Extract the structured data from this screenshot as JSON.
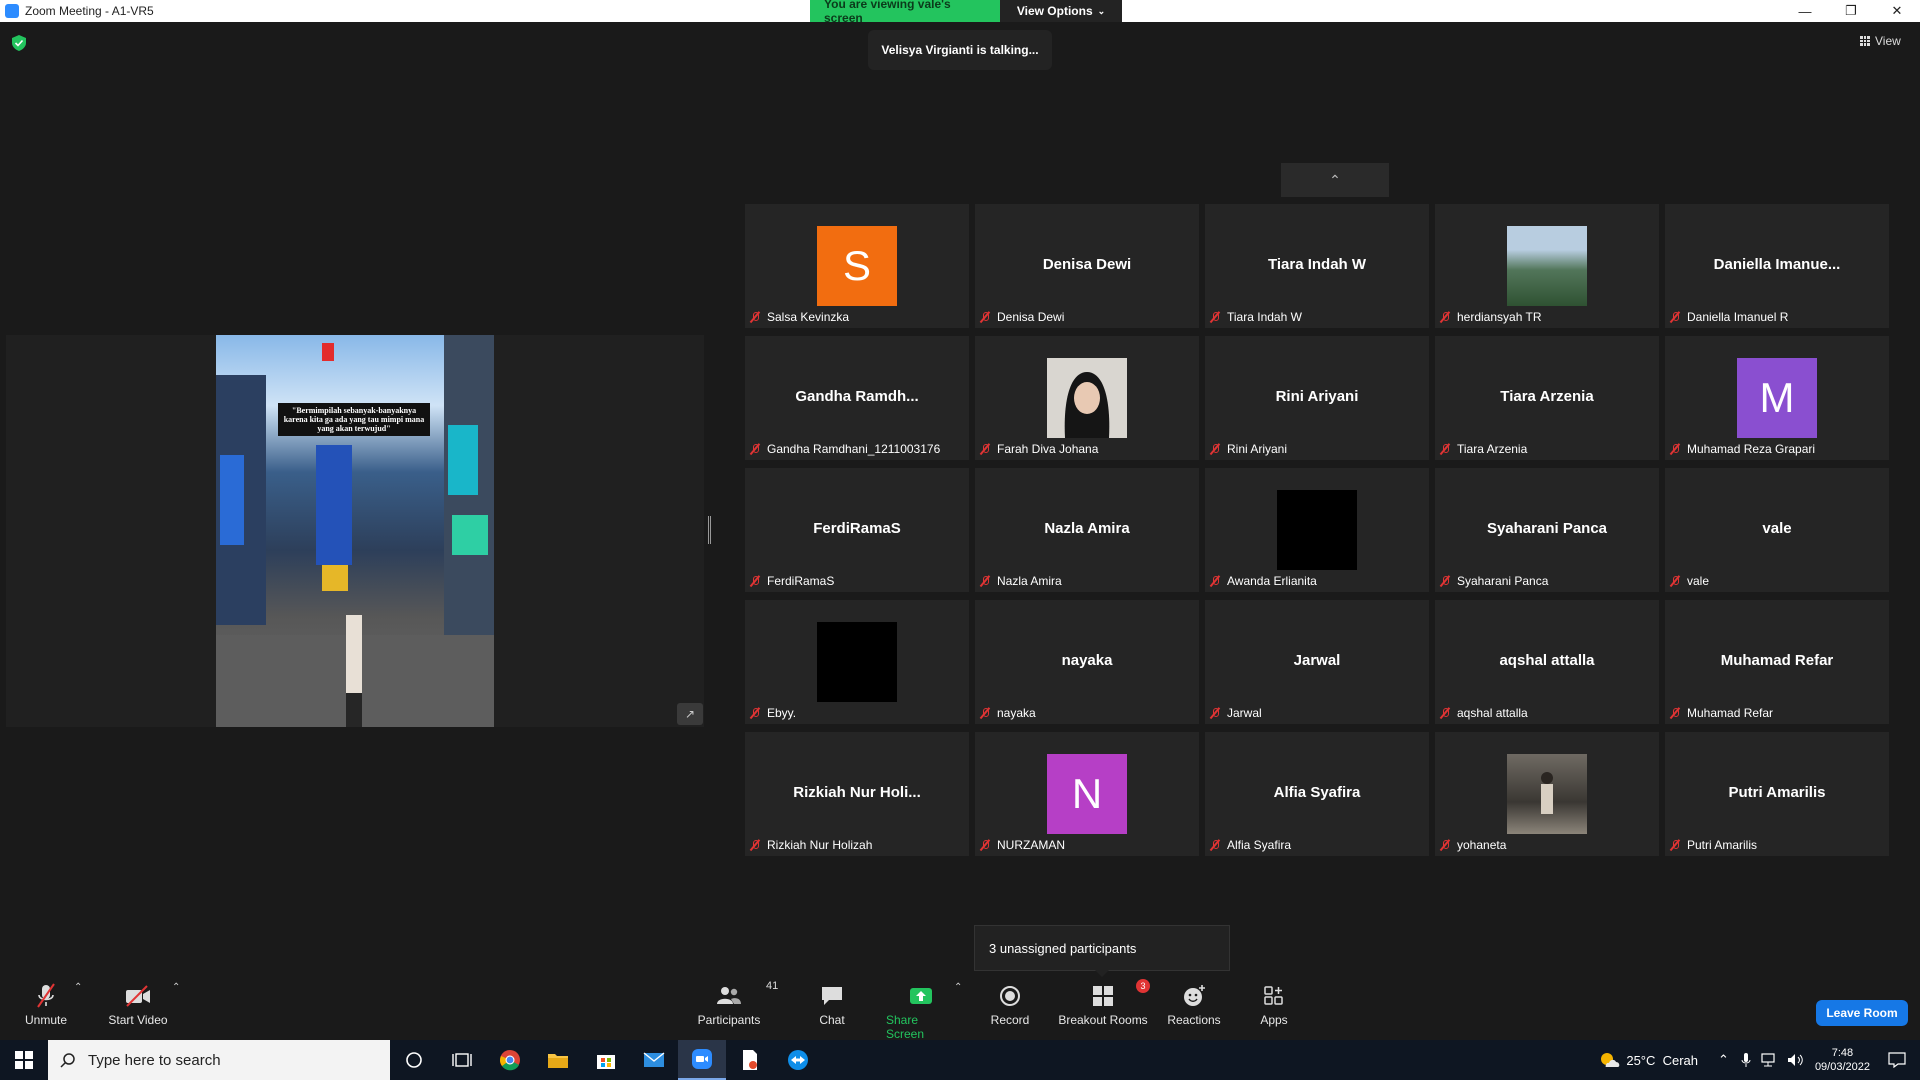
{
  "window": {
    "title": "Zoom Meeting - A1-VR5"
  },
  "banner": {
    "viewing": "You are viewing vale's screen",
    "view_options": "View Options"
  },
  "talking": "Velisya Virgianti is talking...",
  "view_label": "View",
  "share": {
    "quote": "\"Bermimpilah sebanyak-banyaknya karena kita ga ada yang tau mimpi mana yang akan terwujud\""
  },
  "participants": [
    {
      "display": "",
      "label": "Salsa Kevinzka",
      "avatar_letter": "S",
      "avatar_color": "#f26d10"
    },
    {
      "display": "Denisa Dewi",
      "label": "Denisa Dewi"
    },
    {
      "display": "Tiara Indah W",
      "label": "Tiara Indah W"
    },
    {
      "display": "",
      "label": "herdiansyah TR",
      "photo": "landscape"
    },
    {
      "display": "Daniella  Imanue...",
      "label": "Daniella Imanuel R"
    },
    {
      "display": "Gandha  Ramdh...",
      "label": "Gandha Ramdhani_1211003176"
    },
    {
      "display": "",
      "label": "Farah Diva Johana",
      "photo": "portrait"
    },
    {
      "display": "Rini Ariyani",
      "label": "Rini Ariyani"
    },
    {
      "display": "Tiara Arzenia",
      "label": "Tiara Arzenia"
    },
    {
      "display": "",
      "label": "Muhamad Reza Grapari",
      "avatar_letter": "M",
      "avatar_color": "#8a4fd0"
    },
    {
      "display": "FerdiRamaS",
      "label": "FerdiRamaS"
    },
    {
      "display": "Nazla Amira",
      "label": "Nazla Amira"
    },
    {
      "display": "",
      "label": "Awanda Erlianita",
      "photo": "black"
    },
    {
      "display": "Syaharani Panca",
      "label": "Syaharani Panca"
    },
    {
      "display": "vale",
      "label": "vale"
    },
    {
      "display": "",
      "label": "Ebyy.",
      "photo": "black"
    },
    {
      "display": "nayaka",
      "label": "nayaka"
    },
    {
      "display": "Jarwal",
      "label": "Jarwal"
    },
    {
      "display": "aqshal attalla",
      "label": "aqshal attalla"
    },
    {
      "display": "Muhamad Refar",
      "label": "Muhamad Refar"
    },
    {
      "display": "Rizkiah  Nur  Holi...",
      "label": "Rizkiah Nur Holizah"
    },
    {
      "display": "",
      "label": "NURZAMAN",
      "avatar_letter": "N",
      "avatar_color": "#b63fc6"
    },
    {
      "display": "Alfia Syafira",
      "label": "Alfia Syafira"
    },
    {
      "display": "",
      "label": "yohaneta",
      "photo": "street"
    },
    {
      "display": "Putri Amarilis",
      "label": "Putri Amarilis"
    }
  ],
  "unassigned": "3 unassigned participants",
  "toolbar": {
    "unmute": "Unmute",
    "start_video": "Start Video",
    "participants": "Participants",
    "participants_count": "41",
    "chat": "Chat",
    "share_screen": "Share Screen",
    "record": "Record",
    "breakout_rooms": "Breakout Rooms",
    "breakout_badge": "3",
    "reactions": "Reactions",
    "apps": "Apps",
    "leave": "Leave Room"
  },
  "taskbar": {
    "search_placeholder": "Type here to search",
    "weather": "25°C  Cerah",
    "time": "7:48",
    "date": "09/03/2022"
  },
  "colors": {
    "share_green": "#23c45e",
    "leave_blue": "#1678e6",
    "mute_red": "#e03434"
  }
}
